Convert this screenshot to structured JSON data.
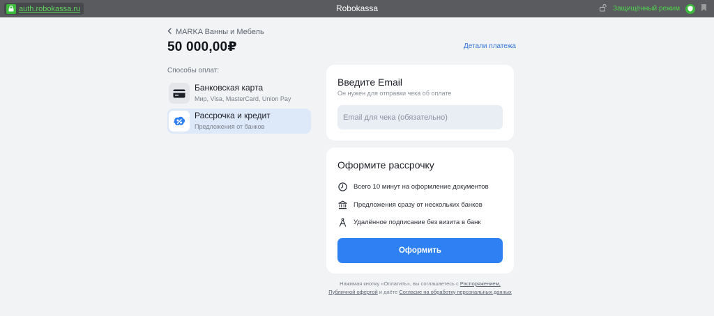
{
  "browser": {
    "url": "auth.robokassa.ru",
    "title": "Robokassa",
    "secure_label": "Защищённый режим"
  },
  "header": {
    "merchant": "MARKA Ванны и Мебель",
    "amount": "50 000,00₽",
    "details_link": "Детали платежа"
  },
  "methods": {
    "title": "Способы оплат:",
    "items": [
      {
        "name": "Банковская карта",
        "sub": "Мир, Visa, MasterCard, Union Pay",
        "icon": "credit-card-icon",
        "selected": false
      },
      {
        "name": "Рассрочка и кредит",
        "sub": "Предложения от банков",
        "icon": "installment-icon",
        "selected": true
      }
    ]
  },
  "email_card": {
    "title": "Введите Email",
    "sub": "Он нужен для отправки чека об оплате",
    "placeholder": "Email для чека (обязательно)",
    "value": ""
  },
  "credit_card": {
    "title": "Оформите рассрочку",
    "features": [
      {
        "text": "Всего 10 минут на оформление документов",
        "icon": "clock-icon"
      },
      {
        "text": "Предложения сразу от нескольких банков",
        "icon": "bank-icon"
      },
      {
        "text": "Удалённое подписание без визита в банк",
        "icon": "compass-pen-icon"
      }
    ],
    "button": "Оформить"
  },
  "legal": {
    "prefix": "Нажимая кнопку «Оплатить», вы соглашаетесь с ",
    "link1": "Распоряжением,",
    "link2": "Публичной офертой",
    "middle": " и даёте ",
    "link3": "Согласие на обработку персональных данных"
  },
  "colors": {
    "accent": "#2f80f2",
    "selected_bg": "#dde9f8",
    "secure_green": "#3dbb3d",
    "page_bg": "#f2f3f5"
  }
}
